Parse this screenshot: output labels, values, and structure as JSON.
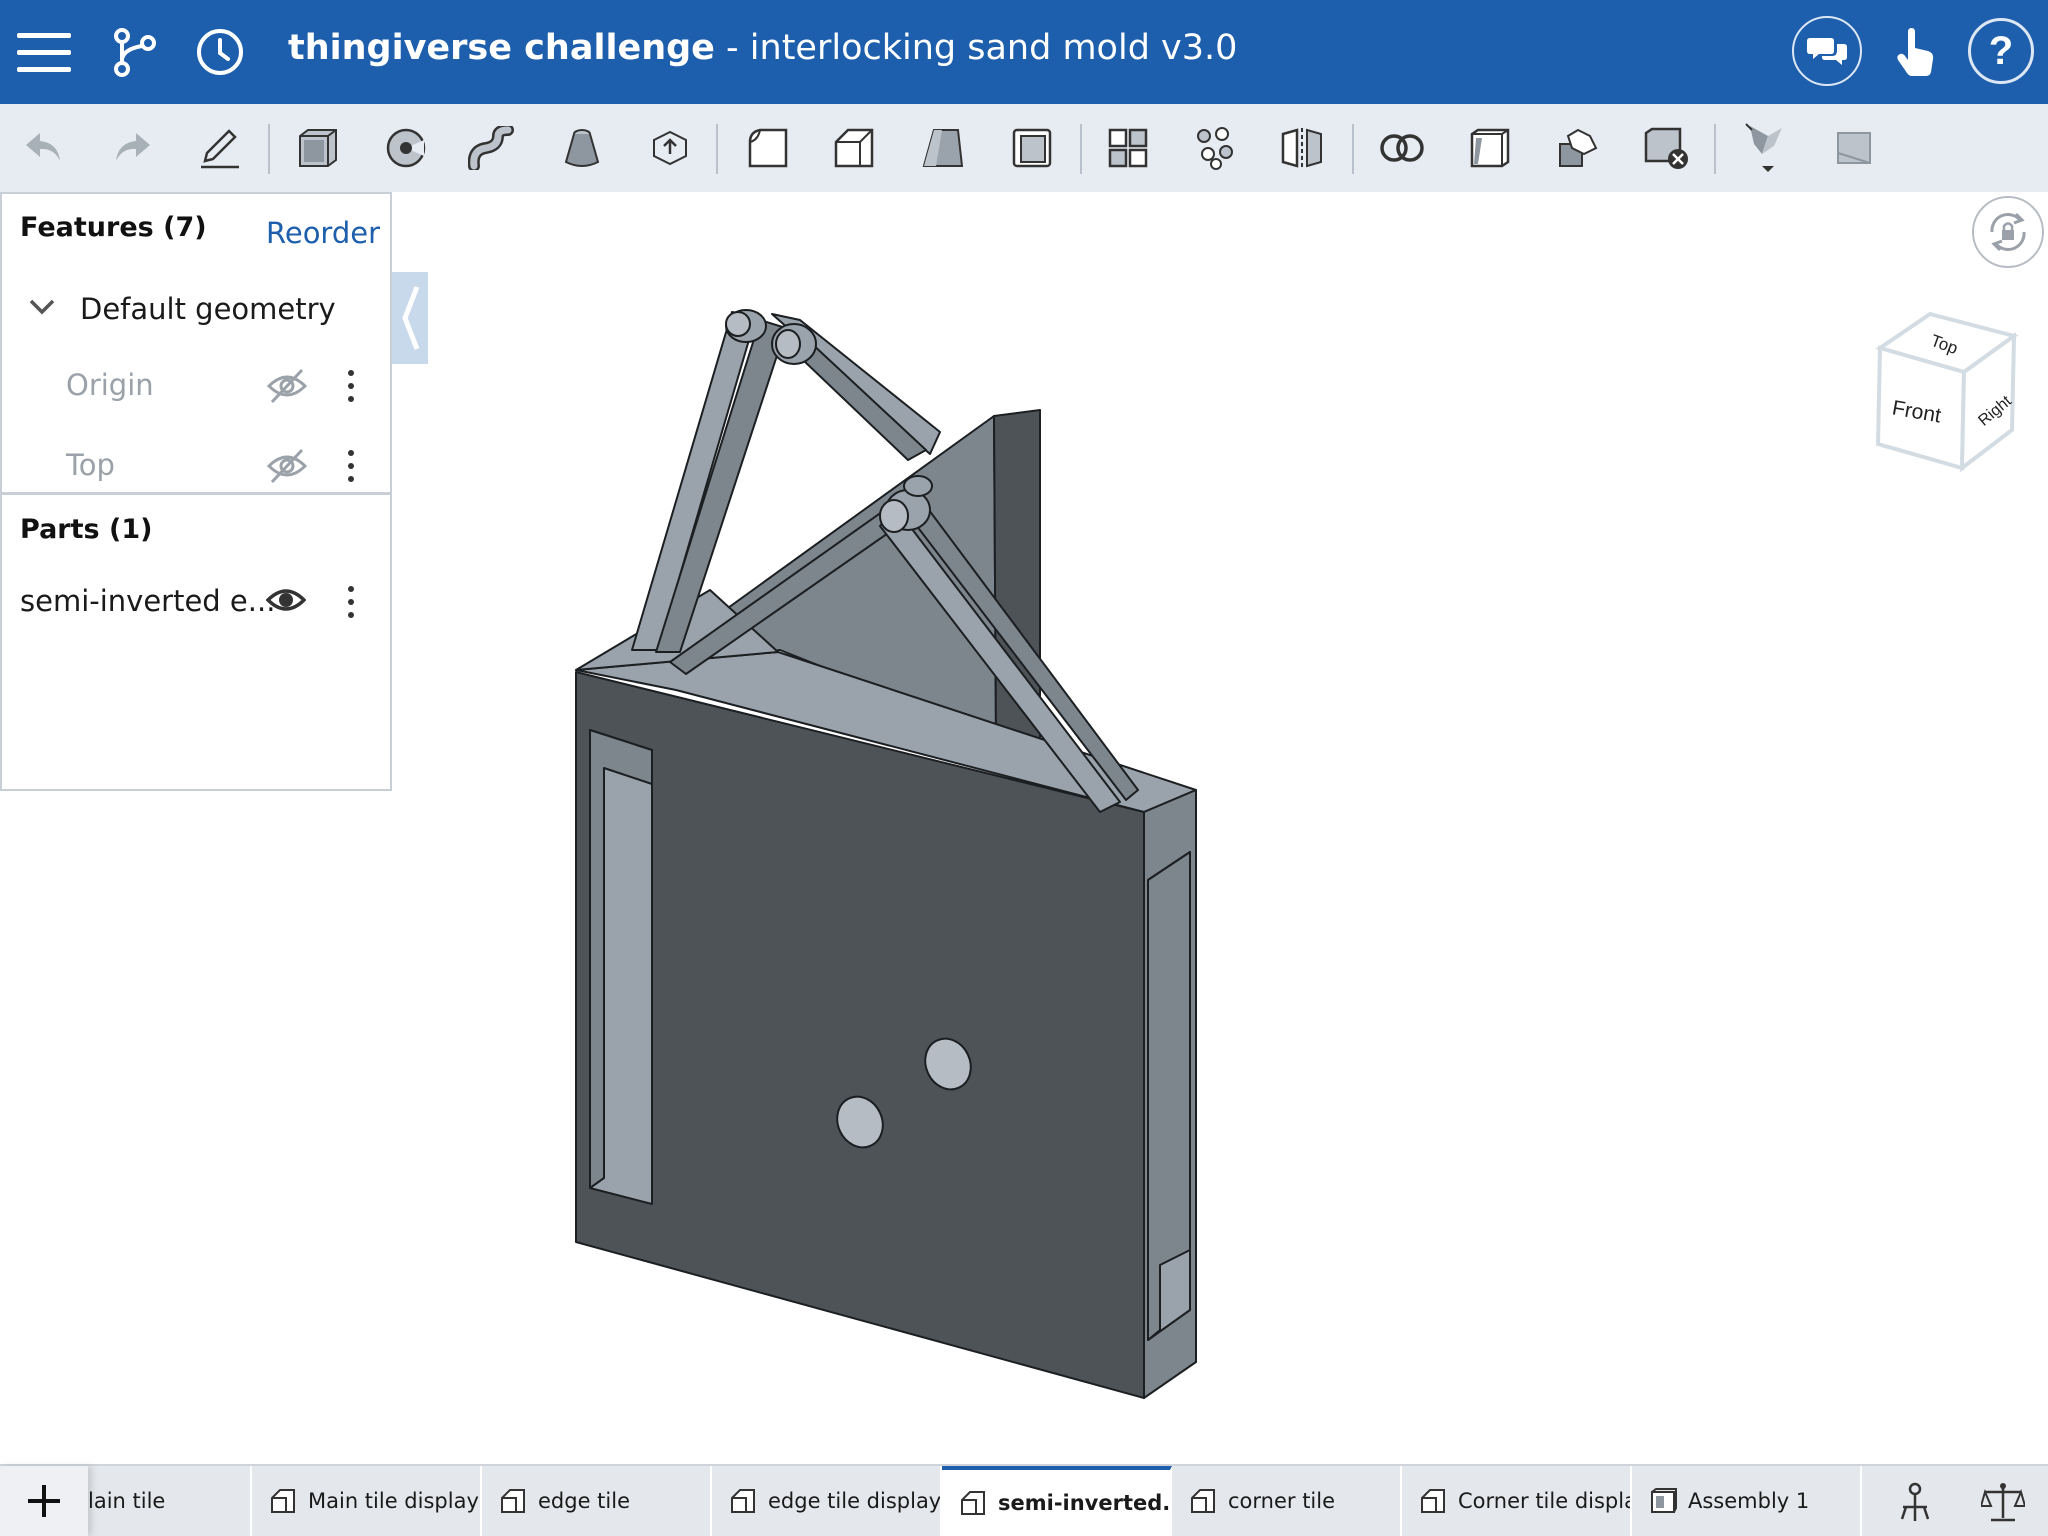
{
  "header": {
    "project": "thingiverse challenge",
    "separator": " - ",
    "version": "interlocking sand mold v3.0"
  },
  "feature_panel": {
    "features_title": "Features (7)",
    "reorder_label": "Reorder",
    "default_geometry_label": "Default geometry",
    "features": [
      {
        "label": "Origin",
        "visibility": "hidden"
      },
      {
        "label": "Top",
        "visibility": "hidden"
      }
    ],
    "parts_title": "Parts (1)",
    "parts": [
      {
        "label": "semi-inverted e...",
        "visibility": "visible"
      }
    ]
  },
  "view_cube": {
    "top": "Top",
    "front": "Front",
    "right": "Right"
  },
  "tabs": [
    {
      "label": "lain tile",
      "icon": "part-studio-icon",
      "active": false
    },
    {
      "label": "Main tile display",
      "icon": "part-studio-icon",
      "active": false
    },
    {
      "label": "edge tile",
      "icon": "part-studio-icon",
      "active": false
    },
    {
      "label": "edge tile display",
      "icon": "part-studio-icon",
      "active": false
    },
    {
      "label": "semi-inverted...",
      "icon": "part-studio-icon",
      "active": true
    },
    {
      "label": "corner tile",
      "icon": "part-studio-icon",
      "active": false
    },
    {
      "label": "Corner tile display",
      "icon": "part-studio-icon",
      "active": false
    },
    {
      "label": "Assembly 1",
      "icon": "assembly-icon",
      "active": false
    }
  ],
  "colors": {
    "header_bg": "#1d5fac",
    "toolbar_bg": "#e7ecf2",
    "accent": "#1d5fac",
    "model_face_dark": "#4e5358",
    "model_face_mid": "#7d858d",
    "model_face_light": "#9aa3ac"
  }
}
